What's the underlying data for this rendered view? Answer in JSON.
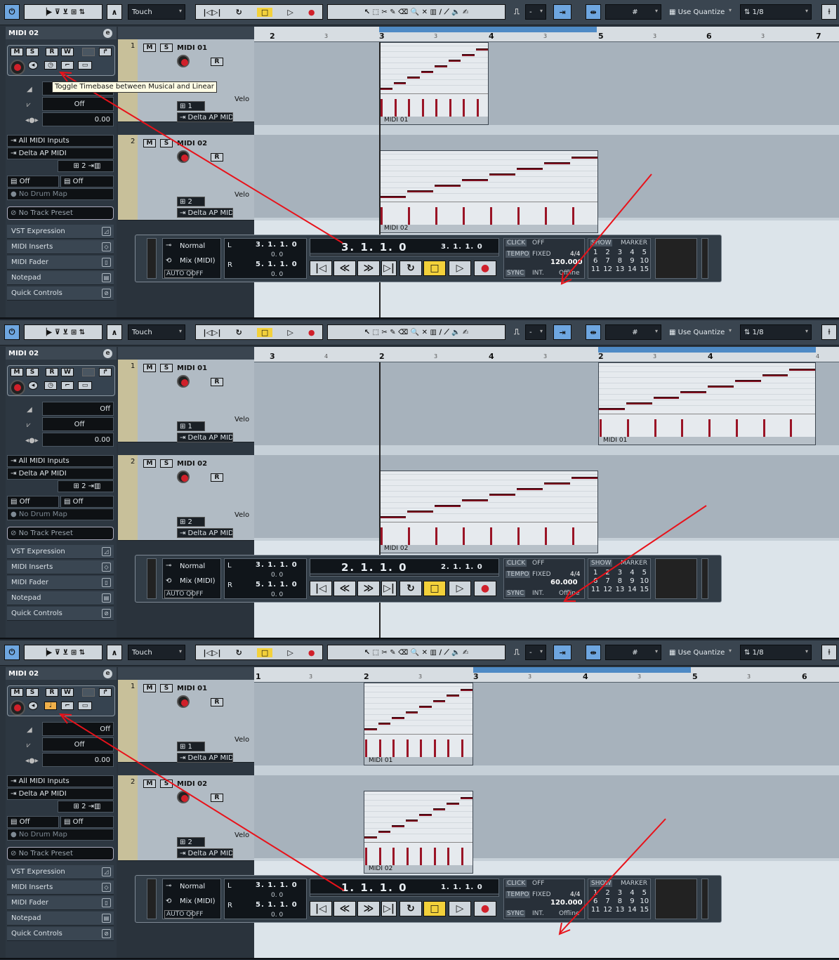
{
  "panels": [
    {
      "toolbar": {
        "automation_mode": "Touch",
        "snap_value": "-",
        "grid_mode": "Use Quantize",
        "quantize": "1/8"
      },
      "inspector": {
        "track_title": "MIDI 02",
        "fader1": "",
        "fader2": "Off",
        "fader3": "0.00",
        "input": "All MIDI Inputs",
        "output": "Delta AP MIDI",
        "channel": "2",
        "map1": "Off",
        "map2": "Off",
        "drum_map": "No Drum Map",
        "preset": "No Track Preset"
      },
      "sections": [
        "VST Expression",
        "MIDI Inserts",
        "MIDI Fader",
        "Notepad",
        "Quick Controls"
      ],
      "tracks": [
        {
          "num": "1",
          "name": "MIDI 01",
          "channel": "1",
          "output": "Delta AP MIDI",
          "off": "Off",
          "velo": "Velo"
        },
        {
          "num": "2",
          "name": "MIDI 02",
          "channel": "2",
          "output": "Delta AP MIDI",
          "off": "Off",
          "velo": "Velo"
        }
      ],
      "ruler": {
        "marks": [
          "2",
          "3",
          "3",
          "3",
          "4",
          "3",
          "5",
          "3",
          "6",
          "3",
          "7"
        ]
      },
      "parts": [
        {
          "name": "MIDI 01"
        },
        {
          "name": "MIDI 02"
        }
      ],
      "transport": {
        "mode": "Normal",
        "mix": "Mix (MIDI)",
        "autoq": "AUTO Q",
        "autoq_val": "OFF",
        "left_loc": "3. 1. 1.   0",
        "right_loc": "5. 1. 1.   0",
        "sub_loc": "0.   0",
        "pos_main": "3. 1. 1.   0",
        "pos_sub": "3. 1. 1.   0",
        "click": "CLICK",
        "click_val": "OFF",
        "tempo": "TEMPO",
        "tempo_mode": "FIXED",
        "sig": "4/4",
        "tempo_val": "120.000",
        "sync": "SYNC",
        "sync_val": "INT.",
        "offline": "Offline",
        "show": "SHOW",
        "marker": "MARKER",
        "markers": [
          "1",
          "2",
          "3",
          "4",
          "5",
          "6",
          "7",
          "8",
          "9",
          "10",
          "11",
          "12",
          "13",
          "14",
          "15"
        ]
      },
      "tooltip": "Toggle Timebase between Musical and Linear"
    },
    {
      "toolbar": {
        "automation_mode": "Touch",
        "snap_value": "-",
        "grid_mode": "Use Quantize",
        "quantize": "1/8"
      },
      "inspector": {
        "track_title": "MIDI 02",
        "fader1": "Off",
        "fader2": "Off",
        "fader3": "0.00",
        "input": "All MIDI Inputs",
        "output": "Delta AP MIDI",
        "channel": "2",
        "map1": "Off",
        "map2": "Off",
        "drum_map": "No Drum Map",
        "preset": "No Track Preset"
      },
      "sections": [
        "VST Expression",
        "MIDI Inserts",
        "MIDI Fader",
        "Notepad",
        "Quick Controls"
      ],
      "tracks": [
        {
          "num": "1",
          "name": "MIDI 01",
          "channel": "1",
          "output": "Delta AP MIDI",
          "off": "Off",
          "velo": "Velo"
        },
        {
          "num": "2",
          "name": "MIDI 02",
          "channel": "2",
          "output": "Delta AP MIDI",
          "off": "Off",
          "velo": "Velo"
        }
      ],
      "ruler": {
        "marks": [
          "3",
          "4",
          "2",
          "3",
          "4",
          "3",
          "2",
          "3",
          "4",
          "4"
        ]
      },
      "parts": [
        {
          "name": "MIDI 01"
        },
        {
          "name": "MIDI 02"
        }
      ],
      "transport": {
        "mode": "Normal",
        "mix": "Mix (MIDI)",
        "autoq": "AUTO Q",
        "autoq_val": "OFF",
        "left_loc": "3. 1. 1.   0",
        "right_loc": "5. 1. 1.   0",
        "sub_loc": "0.   0",
        "pos_main": "2. 1. 1.   0",
        "pos_sub": "2. 1. 1.   0",
        "click": "CLICK",
        "click_val": "OFF",
        "tempo": "TEMPO",
        "tempo_mode": "FIXED",
        "sig": "4/4",
        "tempo_val": "60.000",
        "sync": "SYNC",
        "sync_val": "INT.",
        "offline": "Offline",
        "show": "SHOW",
        "marker": "MARKER",
        "markers": [
          "1",
          "2",
          "3",
          "4",
          "5",
          "6",
          "7",
          "8",
          "9",
          "10",
          "11",
          "12",
          "13",
          "14",
          "15"
        ]
      }
    },
    {
      "toolbar": {
        "automation_mode": "Touch",
        "snap_value": "-",
        "grid_mode": "Use Quantize",
        "quantize": "1/8"
      },
      "inspector": {
        "track_title": "MIDI 02",
        "fader1": "Off",
        "fader2": "Off",
        "fader3": "0.00",
        "input": "All MIDI Inputs",
        "output": "Delta AP MIDI",
        "channel": "2",
        "map1": "Off",
        "map2": "Off",
        "drum_map": "No Drum Map",
        "preset": "No Track Preset"
      },
      "sections": [
        "VST Expression",
        "MIDI Inserts",
        "MIDI Fader",
        "Notepad",
        "Quick Controls"
      ],
      "tracks": [
        {
          "num": "1",
          "name": "MIDI 01",
          "channel": "1",
          "output": "Delta AP MIDI",
          "off": "Off",
          "velo": "Velo"
        },
        {
          "num": "2",
          "name": "MIDI 02",
          "channel": "2",
          "output": "Delta AP MIDI",
          "off": "Off",
          "velo": "Velo"
        }
      ],
      "ruler": {
        "marks": [
          "1",
          "3",
          "2",
          "3",
          "3",
          "3",
          "4",
          "3",
          "5",
          "3",
          "6"
        ]
      },
      "parts": [
        {
          "name": "MIDI 01"
        },
        {
          "name": "MIDI 02"
        }
      ],
      "transport": {
        "mode": "Normal",
        "mix": "Mix (MIDI)",
        "autoq": "AUTO Q",
        "autoq_val": "OFF",
        "left_loc": "3. 1. 1.   0",
        "right_loc": "5. 1. 1.   0",
        "sub_loc": "0.   0",
        "pos_main": "1. 1. 1.   0",
        "pos_sub": "1. 1. 1.   0",
        "click": "CLICK",
        "click_val": "OFF",
        "tempo": "TEMPO",
        "tempo_mode": "FIXED",
        "sig": "4/4",
        "tempo_val": "120.000",
        "sync": "SYNC",
        "sync_val": "INT.",
        "offline": "Offline",
        "show": "SHOW",
        "marker": "MARKER",
        "markers": [
          "1",
          "2",
          "3",
          "4",
          "5",
          "6",
          "7",
          "8",
          "9",
          "10",
          "11",
          "12",
          "13",
          "14",
          "15"
        ]
      }
    }
  ],
  "annotation_color": "#e8121a",
  "note_color": "#7d1020"
}
